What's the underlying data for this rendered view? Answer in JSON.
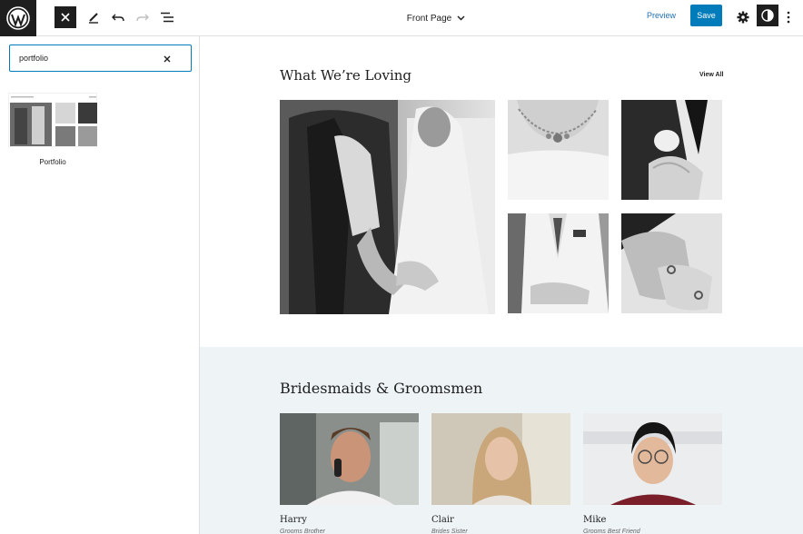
{
  "topbar": {
    "document_title": "Front Page",
    "preview_label": "Preview",
    "save_label": "Save"
  },
  "sidebar": {
    "search": {
      "value": "portfolio",
      "placeholder": "Search"
    },
    "results": [
      {
        "label": "Portfolio"
      }
    ]
  },
  "canvas": {
    "section_loving": {
      "title": "What We’re Loving",
      "view_all": "View All"
    },
    "section_party": {
      "title": "Bridesmaids & Groomsmen",
      "people": [
        {
          "name": "Harry",
          "role": "Grooms Brother"
        },
        {
          "name": "Clair",
          "role": "Brides Sister"
        },
        {
          "name": "Mike",
          "role": "Grooms Best Friend"
        }
      ]
    }
  },
  "colors": {
    "accent": "#007cba",
    "dark": "#1e1e1e",
    "section_bg": "#eef3f6"
  }
}
